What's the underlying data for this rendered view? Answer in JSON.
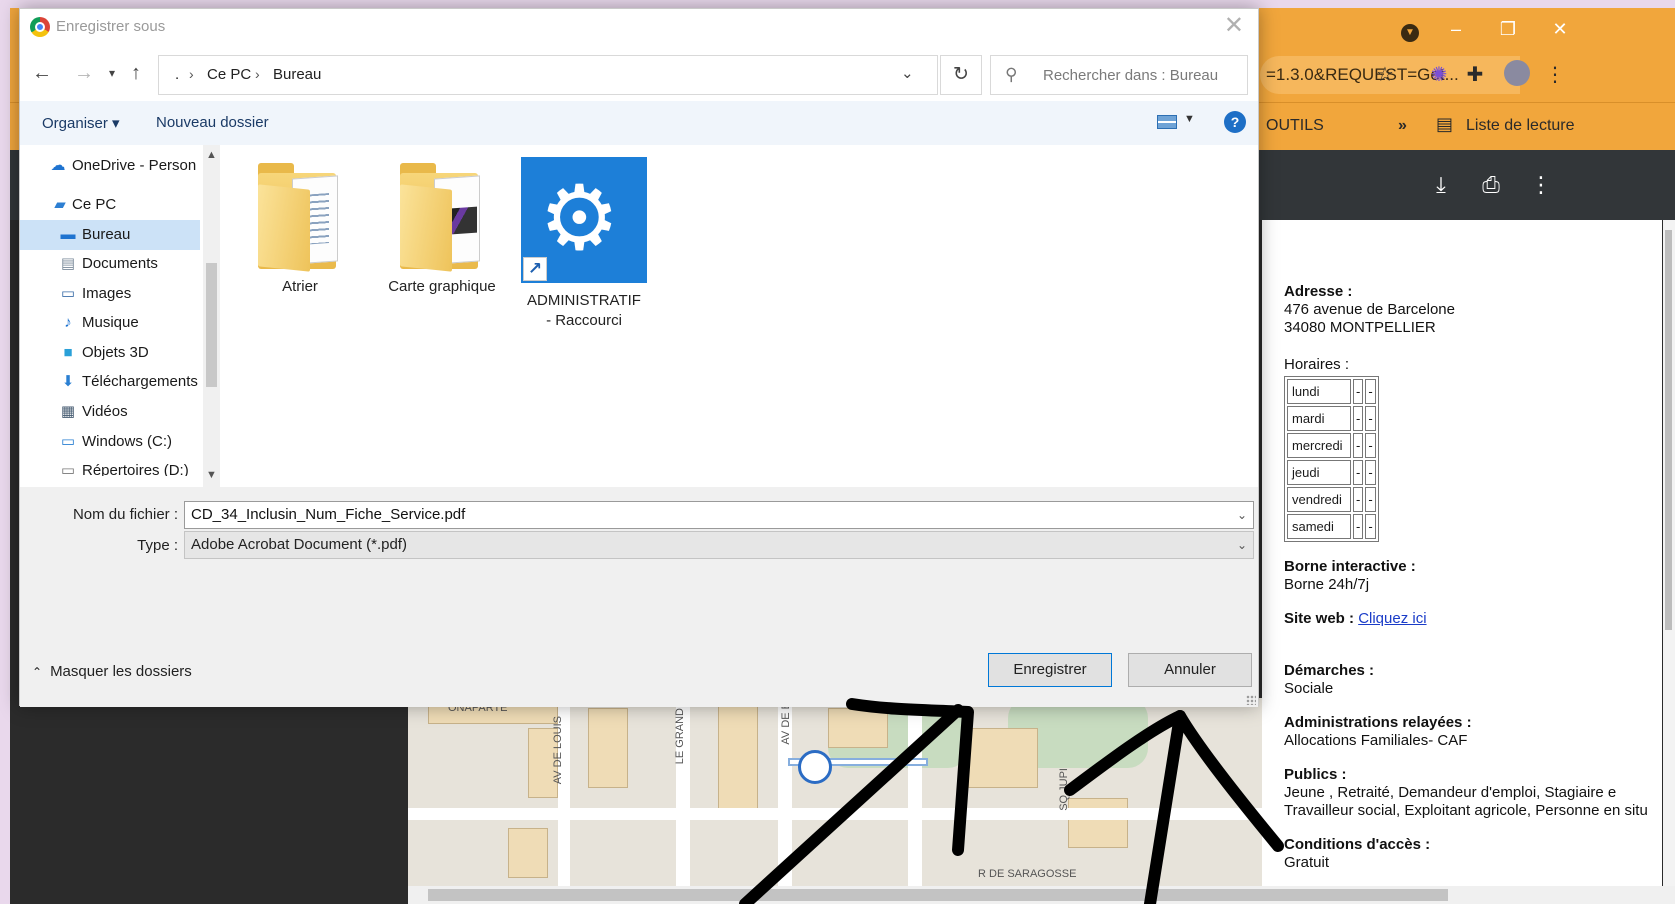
{
  "browser": {
    "url_fragment": "=1.3.0&REQUEST=Get...",
    "bookmark_outils": "OUTILS",
    "bookmark_more": "»",
    "reading_list": "Liste de lecture"
  },
  "pdf": {
    "adresse_label": "Adresse :",
    "adresse_line1": "476 avenue de Barcelone",
    "adresse_line2": "34080 MONTPELLIER",
    "horaires_label": "Horaires :",
    "horaires": [
      {
        "day": "lundi",
        "a": "-",
        "b": "-"
      },
      {
        "day": "mardi",
        "a": "-",
        "b": "-"
      },
      {
        "day": "mercredi",
        "a": "-",
        "b": "-"
      },
      {
        "day": "jeudi",
        "a": "-",
        "b": "-"
      },
      {
        "day": "vendredi",
        "a": "-",
        "b": "-"
      },
      {
        "day": "samedi",
        "a": "-",
        "b": "-"
      }
    ],
    "borne_label": "Borne interactive :",
    "borne_value": "Borne 24h/7j",
    "site_label": "Site web :",
    "site_link": "Cliquez ici",
    "demarches_label": "Démarches :",
    "demarches_value": "Sociale",
    "admin_label": "Administrations relayées :",
    "admin_value": "Allocations Familiales- CAF",
    "publics_label": "Publics :",
    "publics_line1": "Jeune , Retraité, Demandeur d'emploi, Stagiaire e",
    "publics_line2": "Travailleur social, Exploitant agricole, Personne en situ",
    "conditions_label": "Conditions d'accès :",
    "conditions_value": "Gratuit",
    "map_labels": {
      "bonaparte": "ONAPARTE",
      "av_louis": "AV DE LOUIS",
      "le_grand": "LE GRAND",
      "av_de_b": "AV DE B",
      "sq_jupi": "SQ JUPI",
      "r_saragosse": "R DE SARAGOSSE"
    }
  },
  "dialog": {
    "title": "Enregistrer sous",
    "close": "✕",
    "breadcrumb": [
      ".",
      "Ce PC",
      "Bureau"
    ],
    "search_placeholder": "Rechercher dans : Bureau",
    "toolbar": {
      "organize": "Organiser ▾",
      "new_folder": "Nouveau dossier",
      "help": "?"
    },
    "nav_items": [
      {
        "label": "OneDrive - Person",
        "icon": "cloud-icon"
      },
      {
        "label": "Ce PC",
        "icon": "computer-icon"
      },
      {
        "label": "Bureau",
        "icon": "desktop-icon",
        "selected": true
      },
      {
        "label": "Documents",
        "icon": "documents-icon"
      },
      {
        "label": "Images",
        "icon": "images-icon"
      },
      {
        "label": "Musique",
        "icon": "music-icon"
      },
      {
        "label": "Objets 3D",
        "icon": "cube-icon"
      },
      {
        "label": "Téléchargements",
        "icon": "download-icon"
      },
      {
        "label": "Vidéos",
        "icon": "video-icon"
      },
      {
        "label": "Windows (C:)",
        "icon": "drive-icon"
      },
      {
        "label": "Répertoires (D:)",
        "icon": "drive-icon"
      }
    ],
    "files": [
      {
        "name": "Atrier",
        "type": "folder"
      },
      {
        "name": "Carte graphique",
        "type": "folder"
      },
      {
        "name_line1": "ADMINISTRATIF",
        "name_line2": "- Raccourci",
        "type": "shortcut"
      }
    ],
    "filename_label": "Nom du fichier :",
    "filename_value": "CD_34_Inclusin_Num_Fiche_Service.pdf",
    "type_label": "Type :",
    "type_value": "Adobe Acrobat Document (*.pdf)",
    "hide_folders": "Masquer les dossiers",
    "save_button": "Enregistrer",
    "cancel_button": "Annuler"
  },
  "colors": {
    "browser_accent": "#f1a63c",
    "selection": "#cce2f7",
    "app_tile": "#1d7fd8"
  }
}
